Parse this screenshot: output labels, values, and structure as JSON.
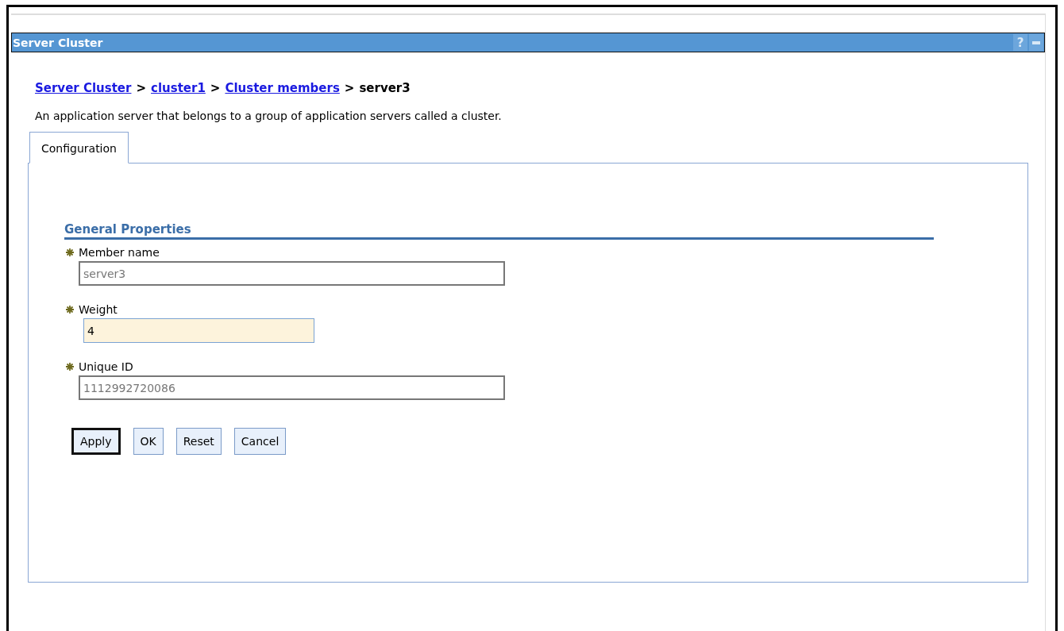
{
  "window": {
    "title": "Server Cluster",
    "help": "?"
  },
  "breadcrumb": [
    {
      "label": "Server Cluster",
      "link": true
    },
    {
      "label": "cluster1",
      "link": true
    },
    {
      "label": "Cluster members",
      "link": true
    },
    {
      "label": "server3",
      "link": false
    }
  ],
  "breadcrumb_separator": ">",
  "description": "An application server that belongs to a group of application servers called a cluster.",
  "tabs": [
    {
      "label": "Configuration",
      "selected": true
    }
  ],
  "section": {
    "title": "General Properties"
  },
  "fields": [
    {
      "label": "Member name",
      "required": true,
      "value": "server3",
      "readonly": true,
      "focused": false
    },
    {
      "label": "Weight",
      "required": true,
      "value": "4",
      "readonly": false,
      "focused": true
    },
    {
      "label": "Unique ID",
      "required": true,
      "value": "1112992720086",
      "readonly": true,
      "focused": false
    }
  ],
  "buttons": [
    {
      "label": "Apply",
      "default": true
    },
    {
      "label": "OK",
      "default": false
    },
    {
      "label": "Reset",
      "default": false
    },
    {
      "label": "Cancel",
      "default": false
    }
  ]
}
